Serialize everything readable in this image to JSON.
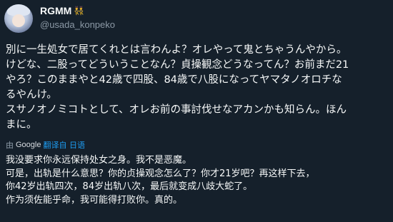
{
  "author": {
    "display_name": "RGMM",
    "name_badges": "👯",
    "handle": "@usada_konpeko",
    "avatar": "avatar-icon"
  },
  "tweet": {
    "lines": [
      "別に一生処女で居てくれとは言わんよ？オレやって鬼とちゃうんやから。",
      "けどな、二股ってどういうことなん？貞操観念どうなってん？お前まだ21",
      "やろ？このままやと42歳で四股、84歳で八股になってヤマタノオロチな",
      "るやんけ。",
      "スサノオノミコトとして、オレお前の事討伐せなアカンかも知らん。ほん",
      "まに。"
    ]
  },
  "translation": {
    "prefix": "由",
    "provider": "Google",
    "action": "翻译自 日语",
    "lines": [
      "我没要求你永远保持处女之身。我不是恶魔。",
      "可是，出轨是什么意思？你的贞操观念怎么了？你才21岁吧？再这样下去，",
      "你42岁出轨四次，84岁出轨八次，最后就变成八歧大蛇了。",
      "作为须佐能乎命，我可能得打败你。真的。"
    ]
  },
  "colors": {
    "background": "#15202b",
    "text": "#f7f9f9",
    "secondary": "#8b98a5",
    "link": "#1d9bf0"
  }
}
